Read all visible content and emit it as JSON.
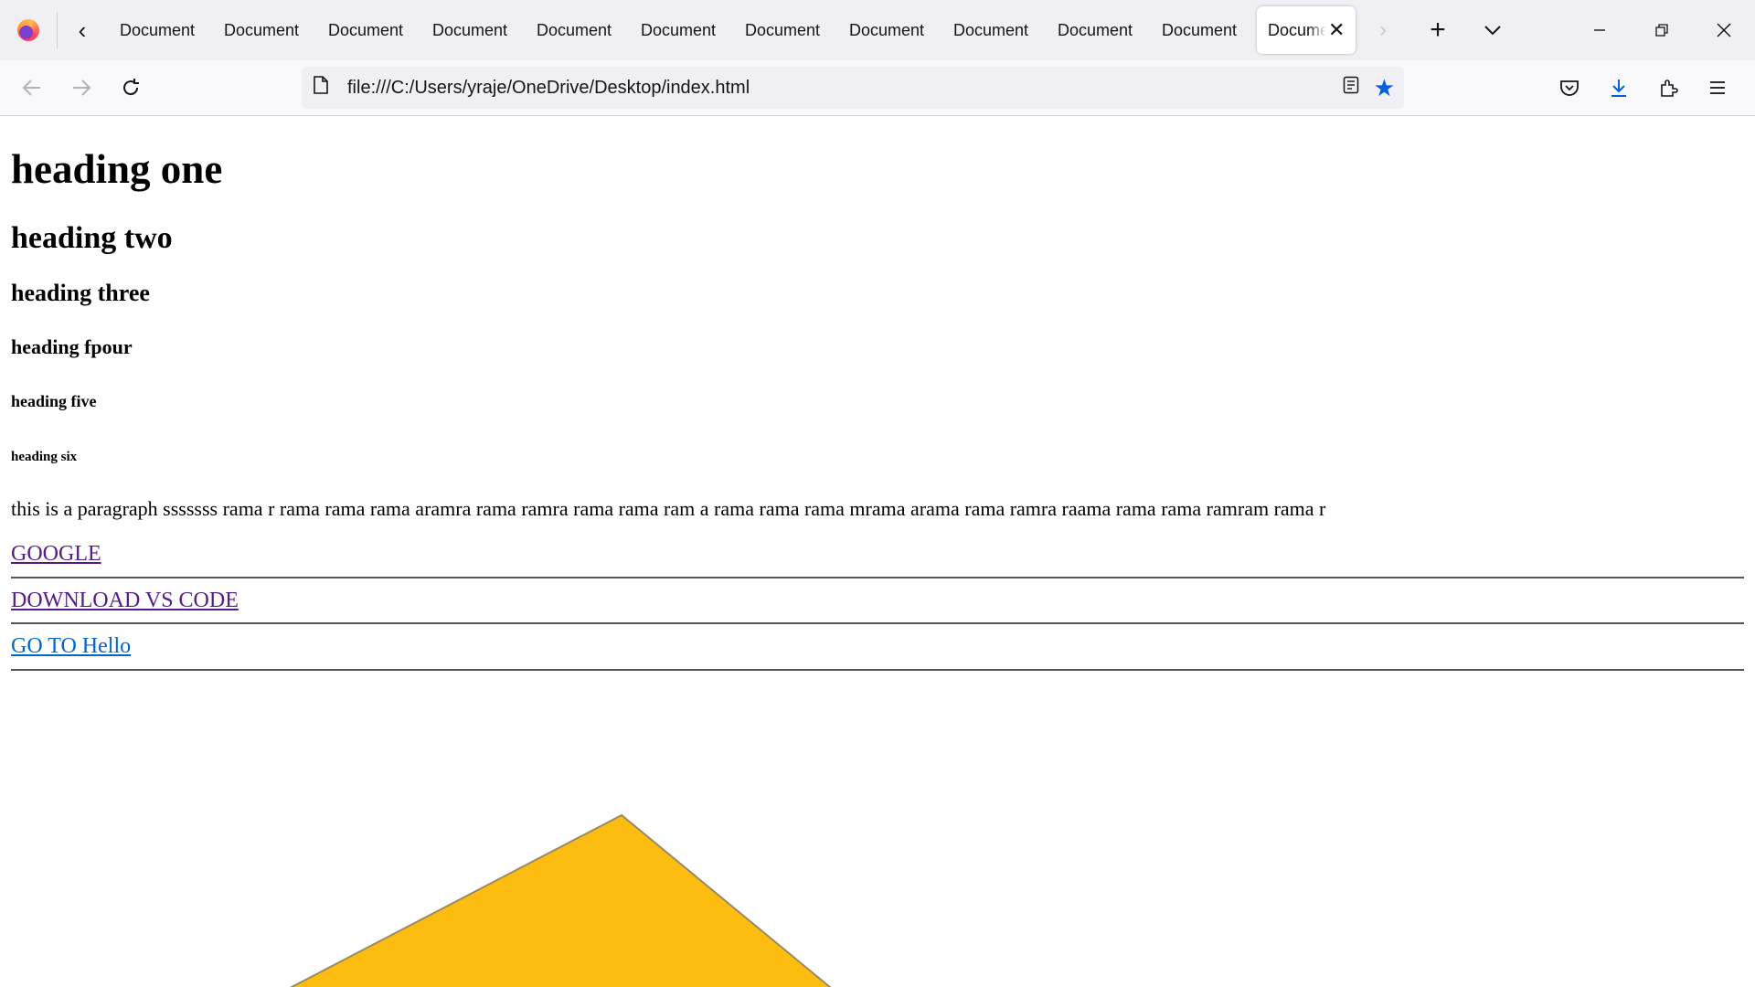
{
  "browser": {
    "tabs": [
      {
        "title": "Document"
      },
      {
        "title": "Document"
      },
      {
        "title": "Document"
      },
      {
        "title": "Document"
      },
      {
        "title": "Document"
      },
      {
        "title": "Document"
      },
      {
        "title": "Document"
      },
      {
        "title": "Document"
      },
      {
        "title": "Document"
      },
      {
        "title": "Document"
      },
      {
        "title": "Document"
      },
      {
        "title": "Document",
        "active": true
      }
    ],
    "url": "file:///C:/Users/yraje/OneDrive/Desktop/index.html",
    "accent_color": "#0061e0",
    "icons": {
      "logo": "firefox-logo",
      "tabs_scroll_left": "chevron-left-icon",
      "tabs_scroll_right": "chevron-right-icon",
      "new_tab": "plus-icon",
      "list_all_tabs": "chevron-down-icon",
      "minimize": "minimize-icon",
      "restore": "restore-icon",
      "close": "close-icon",
      "back": "arrow-left-icon",
      "forward": "arrow-right-icon",
      "reload": "reload-icon",
      "page": "page-icon",
      "reader_view": "reader-view-icon",
      "bookmark": "star-icon",
      "pocket": "pocket-icon",
      "downloads": "download-icon",
      "extensions": "extensions-icon",
      "menu": "hamburger-menu-icon"
    }
  },
  "page": {
    "h1": "heading one",
    "h2": "heading two",
    "h3": "heading three",
    "h4": "heading fpour",
    "h5": "heading five",
    "h6": "heading six",
    "paragraph": "this is a paragraph sssssss rama r rama rama rama aramra rama ramra rama rama ram a rama rama rama mrama arama rama ramra raama rama rama ramram rama r",
    "links": [
      {
        "label": "GOOGLE",
        "visited": true
      },
      {
        "label": "DOWNLOAD VS CODE",
        "visited": true
      },
      {
        "label": "GO TO Hello",
        "visited": false
      }
    ],
    "link_colors": {
      "visited": "#551a8b",
      "unvisited": "#0066cc"
    },
    "image": {
      "fill_color": "#fdbd10",
      "shape": "triangle"
    }
  }
}
